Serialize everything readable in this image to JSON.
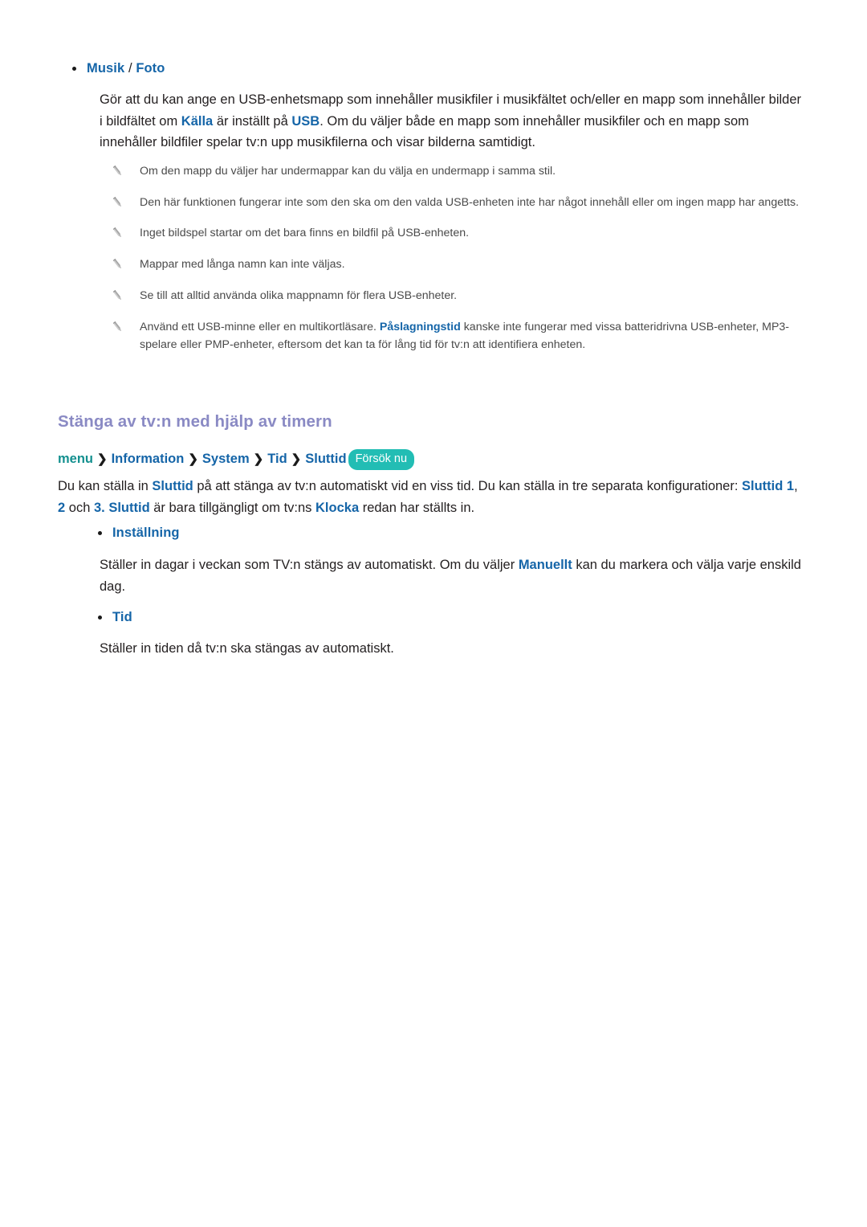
{
  "document": {
    "language": "sv",
    "background_color": "#ffffff",
    "accent_blue": "#1565a8",
    "accent_purple": "#8a8ac4",
    "accent_teal": "#14908f",
    "pill_color": "#22bdb4"
  },
  "music_photo": {
    "bullet_label_1": "Musik",
    "bullet_separator": " / ",
    "bullet_label_2": "Foto",
    "paragraph": {
      "part1": "Gör att du kan ange en USB-enhetsmapp som innehåller musikfiler i musikfältet och/eller en mapp som innehåller bilder i bildfältet om ",
      "term1": "Källa",
      "part2": " är inställt på ",
      "term2": "USB",
      "part3": ". Om du väljer både en mapp som innehåller musikfiler och en mapp som innehåller bildfiler spelar tv:n upp musikfilerna och visar bilderna samtidigt."
    }
  },
  "notes": [
    {
      "icon": "pencil-icon",
      "text": "Om den mapp du väljer har undermappar kan du välja en undermapp i samma stil."
    },
    {
      "icon": "pencil-icon",
      "text": "Den här funktionen fungerar inte som den ska om den valda USB-enheten inte har något innehåll eller om ingen mapp har angetts."
    },
    {
      "icon": "pencil-icon",
      "text": "Inget bildspel startar om det bara finns en bildfil på USB-enheten."
    },
    {
      "icon": "pencil-icon",
      "text": "Mappar med långa namn kan inte väljas."
    },
    {
      "icon": "pencil-icon",
      "text": "Se till att alltid använda olika mappnamn för flera USB-enheter."
    },
    {
      "icon": "pencil-icon",
      "text_part1": "Använd ett USB-minne eller en multikortläsare. ",
      "term": "Påslagningstid",
      "text_part2": " kanske inte fungerar med vissa batteridrivna USB-enheter, MP3-spelare eller PMP-enheter, eftersom det kan ta för lång tid för tv:n att identifiera enheten."
    }
  ],
  "timer_section": {
    "heading": "Stänga av tv:n med hjälp av timern",
    "breadcrumb": {
      "root": "menu",
      "separator": "❯",
      "nodes": [
        "Information",
        "System",
        "Tid",
        "Sluttid"
      ],
      "action_pill": "Försök nu"
    },
    "paragraph": {
      "part1": "Du kan ställa in ",
      "term1": "Sluttid",
      "part2": " på att stänga av tv:n automatiskt vid en viss tid. Du kan ställa in tre separata konfigurationer: ",
      "term2": "Sluttid 1",
      "part3": ", ",
      "term3": "2",
      "part4": " och ",
      "term4": "3.",
      "part5": " ",
      "term5": "Sluttid",
      "part6": " är bara tillgängligt om tv:ns ",
      "term6": "Klocka",
      "part7": " redan har ställts in."
    }
  },
  "installning_section": {
    "bullet_label": "Inställning",
    "paragraph": {
      "part1": "Ställer in dagar i veckan som TV:n stängs av automatiskt. Om du väljer ",
      "term1": "Manuellt",
      "part2": " kan du markera och välja varje enskild dag."
    }
  },
  "tid_section": {
    "bullet_label": "Tid",
    "paragraph": "Ställer in tiden då tv:n ska stängas av automatiskt."
  }
}
